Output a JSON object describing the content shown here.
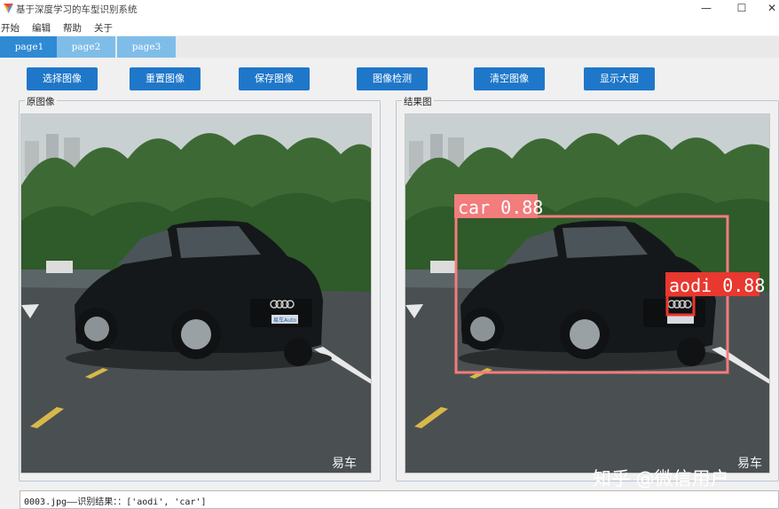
{
  "window": {
    "title": "基于深度学习的车型识别系统",
    "minimize_glyph": "—",
    "maximize_glyph": "☐",
    "close_glyph": "✕"
  },
  "menu": [
    "开始",
    "编辑",
    "帮助",
    "关于"
  ],
  "tabs": [
    "page1",
    "page2",
    "page3"
  ],
  "active_tab": "page1",
  "buttons": {
    "select": "选择图像",
    "reset": "重置图像",
    "save": "保存图像",
    "detect": "图像检测",
    "clear": "清空图像",
    "show_large": "显示大图"
  },
  "original_group": {
    "label": "原图像"
  },
  "result_group": {
    "label": "结果图"
  },
  "image": {
    "plate_text": "易车Auto",
    "brand_watermark": "易车"
  },
  "detections": [
    {
      "label": "car 0.88",
      "color": "#f37c7c"
    },
    {
      "label": "aodi 0.88",
      "color": "#e8382f"
    }
  ],
  "status": {
    "text": "0003.jpg——识别结果：：['aodi', 'car']"
  },
  "watermark": "知乎 @微信用户",
  "colors": {
    "accent": "#1f77c9",
    "tab_active": "#2f8ad4",
    "tab_inactive": "#7fbde9"
  }
}
